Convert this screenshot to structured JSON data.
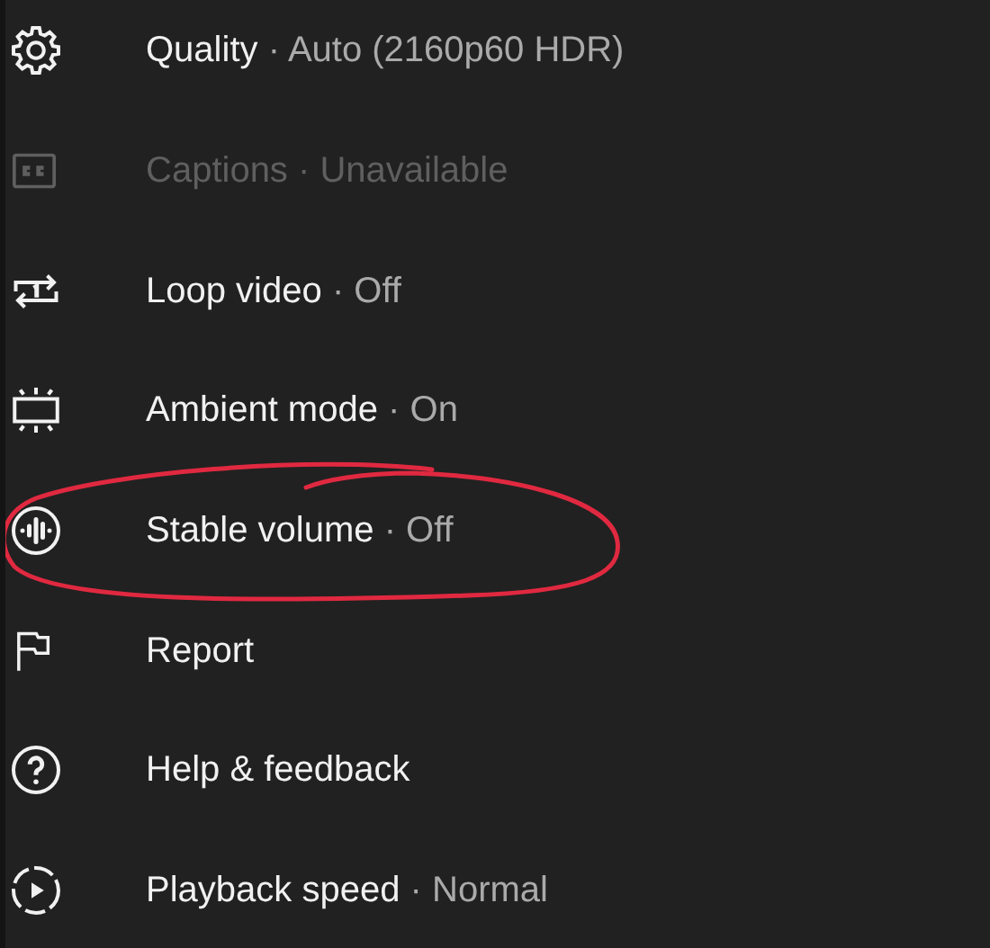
{
  "menu": {
    "items": [
      {
        "label": "Quality",
        "separator": "·",
        "value": "Auto (2160p60 HDR)",
        "disabled": false,
        "circled": false
      },
      {
        "label": "Captions",
        "separator": "·",
        "value": "Unavailable",
        "disabled": true,
        "circled": false
      },
      {
        "label": "Loop video",
        "separator": "·",
        "value": "Off",
        "disabled": false,
        "circled": false
      },
      {
        "label": "Ambient mode",
        "separator": "·",
        "value": "On",
        "disabled": false,
        "circled": false
      },
      {
        "label": "Stable volume",
        "separator": "·",
        "value": "Off",
        "disabled": false,
        "circled": true
      },
      {
        "label": "Report",
        "disabled": false,
        "circled": false
      },
      {
        "label": "Help & feedback",
        "disabled": false,
        "circled": false
      },
      {
        "label": "Playback speed",
        "separator": "·",
        "value": "Normal",
        "disabled": false,
        "circled": false
      }
    ]
  }
}
